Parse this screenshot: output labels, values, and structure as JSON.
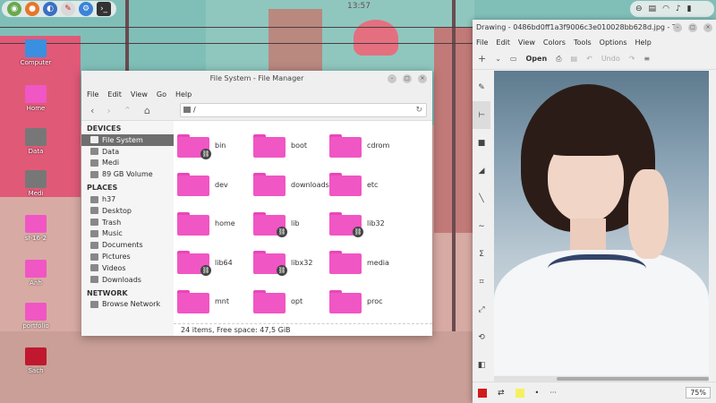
{
  "wallpaper": {
    "clock_text": "13:57"
  },
  "panel": {
    "launcher_icons": [
      "mint-menu-icon",
      "firefox-icon",
      "app-icon",
      "ruler-app-icon",
      "settings-icon",
      "terminal-icon"
    ],
    "tray_icons": [
      "toggle-icon",
      "clipboard-icon",
      "network-icon",
      "volume-icon",
      "battery-icon"
    ]
  },
  "desktop": {
    "icons": [
      {
        "label": "Computer"
      },
      {
        "label": "Home"
      },
      {
        "label": "Data"
      },
      {
        "label": "Medi"
      },
      {
        "label": "sf-16-2"
      },
      {
        "label": "Anh"
      },
      {
        "label": "portfolio"
      },
      {
        "label": "Sach"
      }
    ]
  },
  "file_manager": {
    "title": "File System - File Manager",
    "menu": [
      "File",
      "Edit",
      "View",
      "Go",
      "Help"
    ],
    "path": "/",
    "sidebar": {
      "devices_header": "DEVICES",
      "devices": [
        "File System",
        "Data",
        "Medi",
        "89 GB Volume"
      ],
      "places_header": "PLACES",
      "places": [
        "h37",
        "Desktop",
        "Trash",
        "Music",
        "Documents",
        "Pictures",
        "Videos",
        "Downloads"
      ],
      "network_header": "NETWORK",
      "network": [
        "Browse Network"
      ]
    },
    "items": [
      {
        "name": "bin",
        "link": true
      },
      {
        "name": "boot",
        "link": false
      },
      {
        "name": "cdrom",
        "link": false
      },
      {
        "name": "dev",
        "link": false
      },
      {
        "name": "downloads",
        "link": false
      },
      {
        "name": "etc",
        "link": false
      },
      {
        "name": "home",
        "link": false
      },
      {
        "name": "lib",
        "link": true
      },
      {
        "name": "lib32",
        "link": true
      },
      {
        "name": "lib64",
        "link": true
      },
      {
        "name": "libx32",
        "link": true
      },
      {
        "name": "media",
        "link": false
      },
      {
        "name": "mnt",
        "link": false
      },
      {
        "name": "opt",
        "link": false
      },
      {
        "name": "proc",
        "link": false
      }
    ],
    "status": "24 items, Free space: 47,5 GiB",
    "folder_color": "#f056c4"
  },
  "drawing": {
    "title": "Drawing - 0486bd0ff1a3f9006c3e010028bb628d.jpg - T...",
    "menu": [
      "File",
      "Edit",
      "View",
      "Colors",
      "Tools",
      "Options",
      "Help"
    ],
    "toolbar": {
      "new": "+",
      "open": "Open",
      "undo": "Undo"
    },
    "zoom": "75%",
    "primary_color": "#d11a1a",
    "secondary_color": "#f5f060"
  }
}
